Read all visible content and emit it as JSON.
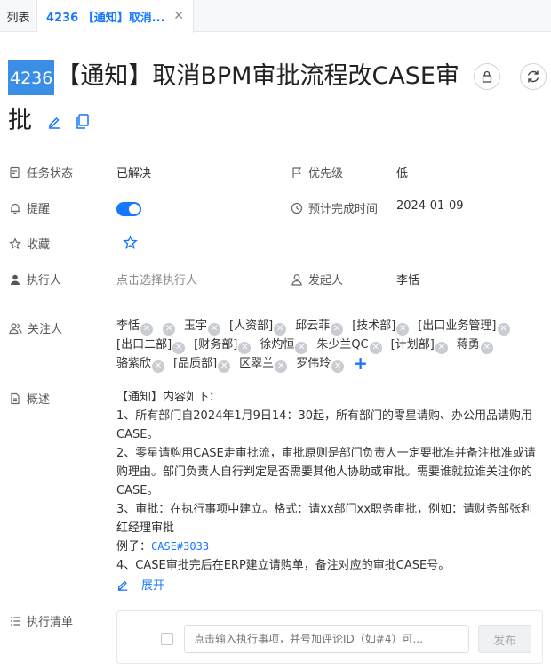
{
  "tabs": [
    {
      "label": "列表"
    },
    {
      "label": "4236 【通知】取消..."
    }
  ],
  "task": {
    "id": "4236",
    "title": "【通知】取消BPM审批流程改CASE审批"
  },
  "fields": {
    "status_label": "任务状态",
    "status_value": "已解决",
    "priority_label": "优先级",
    "priority_value": "低",
    "reminder_label": "提醒",
    "due_label": "预计完成时间",
    "due_value": "2024-01-09",
    "favorite_label": "收藏",
    "assignee_label": "执行人",
    "assignee_placeholder": "点击选择执行人",
    "initiator_label": "发起人",
    "initiator_value": "李恬",
    "followers_label": "关注人",
    "summary_label": "概述",
    "checklist_label": "执行清单"
  },
  "followers": [
    "李恬",
    "",
    "玉宇",
    "[人资部]",
    "邱云菲",
    "[技术部]",
    "[出口业务管理]",
    "[出口二部]",
    "[财务部]",
    "徐灼恒",
    "朱少兰QC",
    "[计划部]",
    "蒋勇",
    "骆紫欣",
    "[品质部]",
    "区翠兰",
    "罗伟玲"
  ],
  "summary": {
    "lines": [
      "【通知】内容如下：",
      "1、所有部门自2024年1月9日14：30起，所有部门的零星请购、办公用品请购用CASE。",
      "2、零星请购用CASE走审批流，审批原则是部门负责人一定要批准并备注批准或请购理由。部门负责人自行判定是否需要其他人协助或审批。需要谁就拉谁关注你的CASE。",
      "3、审批：在执行事项中建立。格式：请xx部门xx职务审批，例如：请财务部张利红经理审批"
    ],
    "example_prefix": "例子：",
    "example_link": "CASE#3033",
    "line4": "4、CASE审批完后在ERP建立请购单，备注对应的审批CASE号。",
    "expand_label": "展开"
  },
  "checklist": {
    "placeholder": "点击输入执行事项，并号加评论ID（如#4）可...",
    "publish_label": "发布"
  },
  "colors": {
    "accent": "#1677ff",
    "badge": "#3b8ee6"
  }
}
